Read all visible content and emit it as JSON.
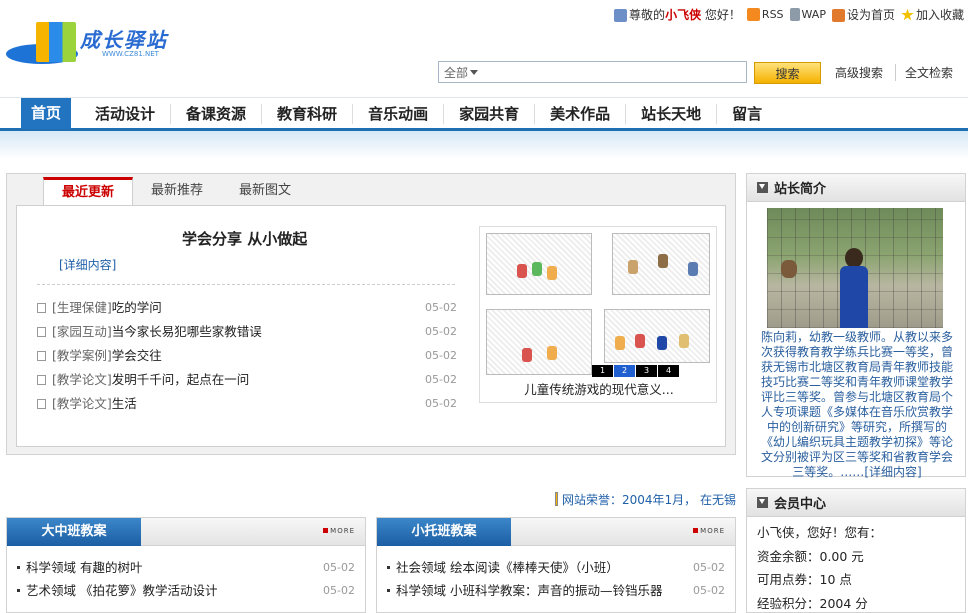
{
  "header": {
    "site_name": "成长驿站",
    "site_url": "WWW.CZ81.NET",
    "greeting_prefix": "尊敬的",
    "username": "小飞侠",
    "greeting_suffix": "您好！",
    "links": [
      "RSS",
      "WAP",
      "设为首页",
      "加入收藏"
    ]
  },
  "search": {
    "scope": "全部",
    "button": "搜索",
    "advanced": "高级搜索",
    "fulltext": "全文检索"
  },
  "nav": [
    "首页",
    "活动设计",
    "备课资源",
    "教育科研",
    "音乐动画",
    "家园共育",
    "美术作品",
    "站长天地",
    "留言"
  ],
  "latest": {
    "tabs": [
      "最近更新",
      "最新推荐",
      "最新图文"
    ],
    "headline": "学会分享  从小做起",
    "detail_link": "[详细内容]",
    "items": [
      {
        "category": "[生理保健]",
        "title": "吃的学问",
        "date": "05-02"
      },
      {
        "category": "[家园互动]",
        "title": "当今家长易犯哪些家教错误",
        "date": "05-02"
      },
      {
        "category": "[教学案例]",
        "title": "学会交往",
        "date": "05-02"
      },
      {
        "category": "[教学论文]",
        "title": "发明千千问，起点在一问",
        "date": "05-02"
      },
      {
        "category": "[教学论文]",
        "title": "生活",
        "date": "05-02"
      }
    ],
    "slideshow": {
      "caption": "儿童传统游戏的现代意义...",
      "pages": [
        "1",
        "2",
        "3",
        "4"
      ],
      "current_page": "2"
    }
  },
  "honor": {
    "text": "网站荣誉：2004年1月，  在无锡"
  },
  "columns": [
    {
      "title": "大中班教案",
      "more": "MORE",
      "items": [
        {
          "title": "科学领域  有趣的树叶",
          "date": "05-02"
        },
        {
          "title": "艺术领域  《拍花箩》教学活动设计",
          "date": "05-02"
        }
      ]
    },
    {
      "title": "小托班教案",
      "more": "MORE",
      "items": [
        {
          "title": "社会领域  绘本阅读《棒棒天使》（小班）",
          "date": "05-02"
        },
        {
          "title": "科学领域  小班科学教案：声音的振动—铃铛乐器",
          "date": "05-02"
        }
      ]
    }
  ],
  "sidebar": {
    "about_title": "站长简介",
    "bio": "陈向莉，幼教一级教师。从教以来多次获得教育教学练兵比赛一等奖，曾获无锡市北塘区教育局青年教师技能技巧比赛二等奖和青年教师课堂教学评比三等奖。曾参与北塘区教育局个人专项课题《多媒体在音乐欣赏教学中的创新研究》等研究，所撰写的《幼儿编织玩具主题教学初探》等论文分别被评为区三等奖和省教育学会三等奖。……",
    "bio_more": "[详细内容]",
    "member_title": "会员中心",
    "member_lines": [
      "小飞侠，您好！您有：",
      "资金余额：0.00 元",
      "可用点券：10 点",
      "经验积分：2004 分"
    ]
  },
  "colors": {
    "nav_active": "#2274c0",
    "nav_underline": "#1f6fb3",
    "tab_active": "#cc0000",
    "search_button": "#f5b100",
    "link_blue": "#1f5fa8"
  }
}
